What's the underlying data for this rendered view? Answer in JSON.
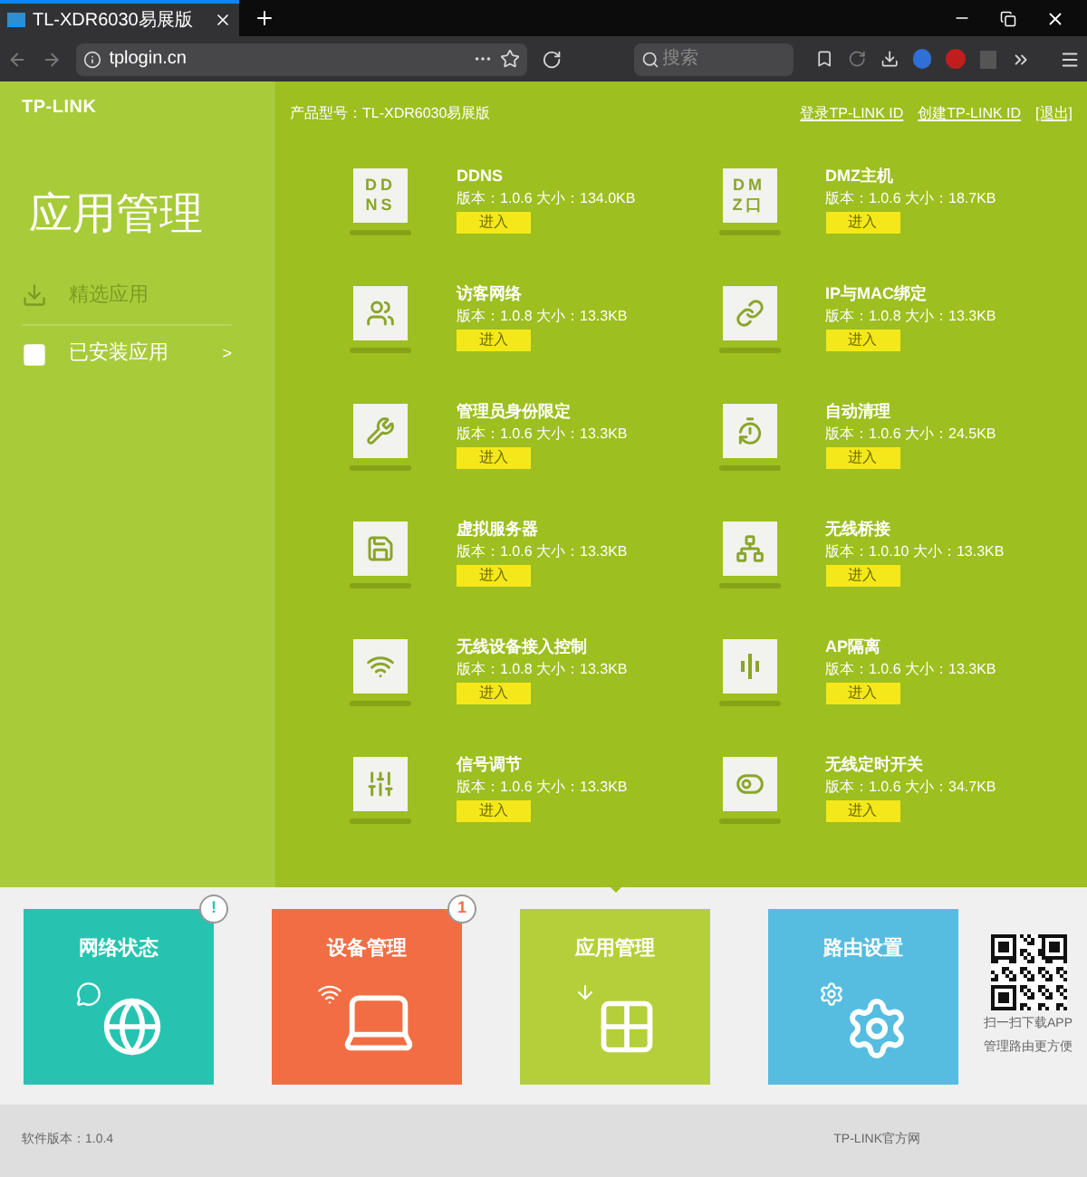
{
  "browser": {
    "tab_title": "TL-XDR6030易展版",
    "url": "tplogin.cn",
    "search": {
      "placeholder": "搜索"
    }
  },
  "header": {
    "logo": "TP-LINK",
    "product_model": "产品型号：TL-XDR6030易展版",
    "links": [
      "登录TP-LINK ID",
      "创建TP-LINK ID",
      "[退出]"
    ]
  },
  "sidebar": {
    "title": "应用管理",
    "items": [
      {
        "label": "精选应用",
        "selected": false
      },
      {
        "label": "已安装应用",
        "selected": true,
        "chevron": ">"
      }
    ]
  },
  "apps": [
    {
      "name": "DDNS",
      "info": "版本：1.0.6 大小：134.0KB",
      "button": "进入",
      "icon_text": [
        "DD",
        "NS"
      ]
    },
    {
      "name": "DMZ主机",
      "info": "版本：1.0.6 大小：18.7KB",
      "button": "进入",
      "icon_text": [
        "DM",
        "Z口"
      ]
    },
    {
      "name": "访客网络",
      "info": "版本：1.0.8 大小：13.3KB",
      "button": "进入"
    },
    {
      "name": "IP与MAC绑定",
      "info": "版本：1.0.8 大小：13.3KB",
      "button": "进入"
    },
    {
      "name": "管理员身份限定",
      "info": "版本：1.0.6 大小：13.3KB",
      "button": "进入"
    },
    {
      "name": "自动清理",
      "info": "版本：1.0.6 大小：24.5KB",
      "button": "进入"
    },
    {
      "name": "虚拟服务器",
      "info": "版本：1.0.6 大小：13.3KB",
      "button": "进入"
    },
    {
      "name": "无线桥接",
      "info": "版本：1.0.10 大小：13.3KB",
      "button": "进入"
    },
    {
      "name": "无线设备接入控制",
      "info": "版本：1.0.8 大小：13.3KB",
      "button": "进入"
    },
    {
      "name": "AP隔离",
      "info": "版本：1.0.6 大小：13.3KB",
      "button": "进入"
    },
    {
      "name": "信号调节",
      "info": "版本：1.0.6 大小：13.3KB",
      "button": "进入"
    },
    {
      "name": "无线定时开关",
      "info": "版本：1.0.6 大小：34.7KB",
      "button": "进入"
    }
  ],
  "nav_tiles": [
    {
      "label": "网络状态",
      "color": "#26c4b0",
      "selected": false,
      "badge": "!"
    },
    {
      "label": "设备管理",
      "color": "#f26d43",
      "selected": false,
      "badge": "1"
    },
    {
      "label": "应用管理",
      "color": "#b5cf3a",
      "selected": true
    },
    {
      "label": "路由设置",
      "color": "#56bde0",
      "selected": false
    }
  ],
  "qr_caption": [
    "扫一扫下载APP",
    "管理路由更方便"
  ],
  "footer": {
    "version": "软件版本：1.0.4",
    "right": "TP-LINK官方网"
  }
}
